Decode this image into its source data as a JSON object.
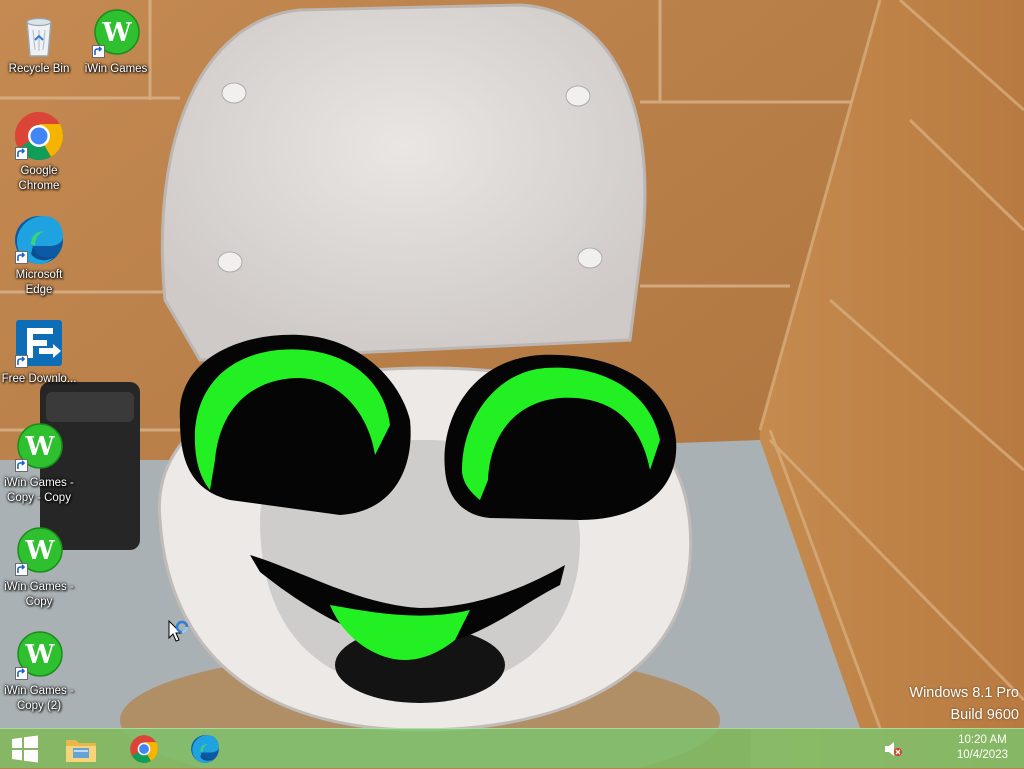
{
  "desktop": {
    "icons": [
      {
        "id": "recycle-bin",
        "label": "Recycle Bin",
        "icon": "recycle-bin-icon"
      },
      {
        "id": "iwin-games",
        "label": "iWin Games",
        "icon": "iwin-icon"
      },
      {
        "id": "google-chrome",
        "label": "Google Chrome",
        "icon": "chrome-icon"
      },
      {
        "id": "microsoft-edge",
        "label": "Microsoft Edge",
        "icon": "edge-icon"
      },
      {
        "id": "free-download",
        "label": "Free Downlo...",
        "icon": "free-download-manager-icon"
      },
      {
        "id": "iwin-copy-copy",
        "label": "iWin Games - Copy - Copy",
        "icon": "iwin-icon"
      },
      {
        "id": "iwin-copy",
        "label": "iWin Games - Copy",
        "icon": "iwin-icon"
      },
      {
        "id": "iwin-copy-2",
        "label": "iWin Games - Copy (2)",
        "icon": "iwin-icon"
      }
    ]
  },
  "watermark": {
    "line1": "Windows 8.1 Pro",
    "line2": "Build 9600"
  },
  "taskbar": {
    "pinned": [
      {
        "name": "file-explorer",
        "icon": "folder-icon"
      },
      {
        "name": "google-chrome",
        "icon": "chrome-icon"
      },
      {
        "name": "microsoft-edge",
        "icon": "edge-icon"
      }
    ],
    "tray": {
      "volume_icon": "volume-muted-icon",
      "time": "10:20 AM",
      "date": "10/4/2023"
    }
  },
  "colors": {
    "taskbar": "#78c86e",
    "iwin_green": "#2ec02e",
    "eye_green": "#22f022"
  }
}
